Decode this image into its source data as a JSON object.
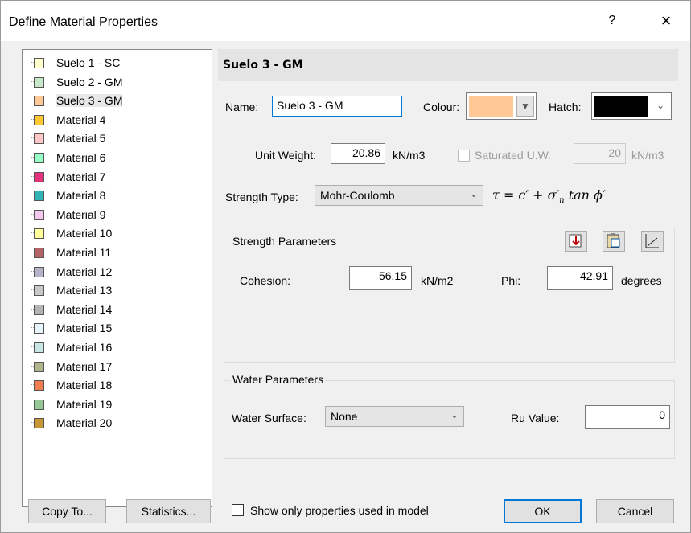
{
  "window": {
    "title": "Define Material Properties",
    "help_label": "?",
    "close_label": "×"
  },
  "materials": [
    {
      "name": "Suelo 1 - SC",
      "color": "#ffffcc"
    },
    {
      "name": "Suelo 2 - GM",
      "color": "#c8e6c8"
    },
    {
      "name": "Suelo 3 - GM",
      "color": "#ffc896",
      "selected": true
    },
    {
      "name": "Material 4",
      "color": "#ffc832"
    },
    {
      "name": "Material 5",
      "color": "#ffc8c8"
    },
    {
      "name": "Material 6",
      "color": "#96ffc8"
    },
    {
      "name": "Material 7",
      "color": "#e6327d"
    },
    {
      "name": "Material 8",
      "color": "#32b4b4"
    },
    {
      "name": "Material 9",
      "color": "#f0c8f0"
    },
    {
      "name": "Material 10",
      "color": "#ffff9b"
    },
    {
      "name": "Material 11",
      "color": "#b46464"
    },
    {
      "name": "Material 12",
      "color": "#b4b4c8"
    },
    {
      "name": "Material 13",
      "color": "#c8c8c8"
    },
    {
      "name": "Material 14",
      "color": "#b4b4b4"
    },
    {
      "name": "Material 15",
      "color": "#e6f5fa"
    },
    {
      "name": "Material 16",
      "color": "#c8e6e6"
    },
    {
      "name": "Material 17",
      "color": "#b4b48c"
    },
    {
      "name": "Material 18",
      "color": "#f07d50"
    },
    {
      "name": "Material 19",
      "color": "#96c896"
    },
    {
      "name": "Material 20",
      "color": "#c89632"
    }
  ],
  "panel": {
    "heading": "Suelo 3 - GM",
    "name_label": "Name:",
    "name_value": "Suelo 3 - GM",
    "colour_label": "Colour:",
    "colour_value": "#ffc896",
    "hatch_label": "Hatch:",
    "hatch_value": "#000000",
    "unit_weight_label": "Unit Weight:",
    "unit_weight_value": "20.86",
    "unit_weight_unit": "kN/m3",
    "saturated_label": "Saturated U.W.",
    "saturated_value": "20",
    "saturated_unit": "kN/m3",
    "strength_type_label": "Strength Type:",
    "strength_type_value": "Mohr-Coulomb"
  },
  "strength_params": {
    "group_label": "Strength Parameters",
    "cohesion_label": "Cohesion:",
    "cohesion_value": "56.15",
    "cohesion_unit": "kN/m2",
    "phi_label": "Phi:",
    "phi_value": "42.91",
    "phi_unit": "degrees",
    "icons": [
      "load-parameters-icon",
      "clipboard-icon",
      "graph-icon"
    ]
  },
  "water_params": {
    "group_label": "Water Parameters",
    "surface_label": "Water Surface:",
    "surface_value": "None",
    "ru_label": "Ru Value:",
    "ru_value": "0"
  },
  "footer": {
    "copy_to": "Copy To...",
    "statistics": "Statistics...",
    "show_only_label": "Show only properties used in model",
    "ok": "OK",
    "cancel": "Cancel"
  }
}
